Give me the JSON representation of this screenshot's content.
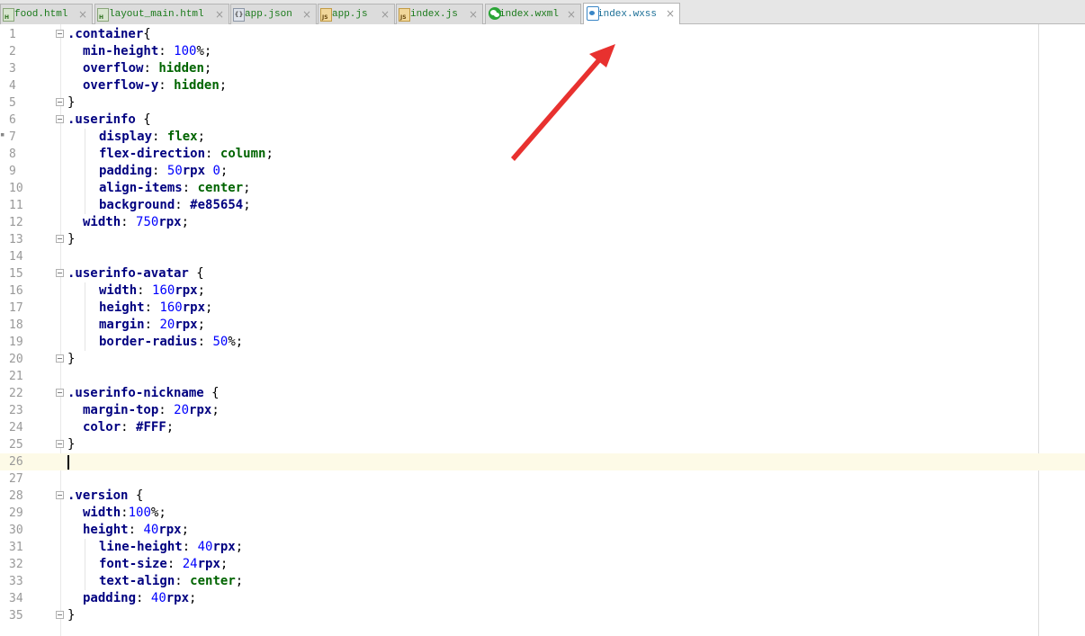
{
  "tabs": [
    {
      "label": "food.html",
      "icon": "html-file-icon",
      "active": false
    },
    {
      "label": "layout_main.html",
      "icon": "html-file-icon",
      "active": false
    },
    {
      "label": "app.json",
      "icon": "json-file-icon",
      "active": false
    },
    {
      "label": "app.js",
      "icon": "js-file-icon",
      "active": false
    },
    {
      "label": "index.js",
      "icon": "js-file-icon",
      "active": false
    },
    {
      "label": "index.wxml",
      "icon": "wechat-file-icon",
      "active": false
    },
    {
      "label": "index.wxss",
      "icon": "wxss-file-icon",
      "active": true
    }
  ],
  "icon_text": {
    "html": "H",
    "js": "JS",
    "json": "{}"
  },
  "close_glyph": "×",
  "editor": {
    "current_line": 26,
    "line_numbers": [
      "1",
      "2",
      "3",
      "4",
      "5",
      "6",
      "7",
      "8",
      "9",
      "10",
      "11",
      "12",
      "13",
      "14",
      "15",
      "16",
      "17",
      "18",
      "19",
      "20",
      "21",
      "22",
      "23",
      "24",
      "25",
      "26",
      "27",
      "28",
      "29",
      "30",
      "31",
      "32",
      "33",
      "34",
      "35"
    ],
    "lines": [
      ".container{",
      "min-height: 100%;",
      "overflow: hidden;",
      "overflow-y: hidden;",
      "}",
      ".userinfo {",
      "display: flex;",
      "flex-direction: column;",
      "padding: 50rpx 0;",
      "align-items: center;",
      "background: #e85654;",
      "width: 750rpx;",
      "}",
      "",
      ".userinfo-avatar {",
      "width: 160rpx;",
      "height: 160rpx;",
      "margin: 20rpx;",
      "border-radius: 50%;",
      "}",
      "",
      ".userinfo-nickname {",
      "margin-top: 20rpx;",
      "color: #FFF;",
      "}",
      "",
      "",
      ".version {",
      "width:100%;",
      "height: 40rpx;",
      "line-height: 40rpx;",
      "font-size: 24rpx;",
      "text-align: center;",
      "padding: 40rpx;",
      "}"
    ]
  },
  "colors": {
    "arrow": "#e8312f",
    "current_line_bg": "#fdfae7",
    "selector": "#000080",
    "keyword": "#006400",
    "number": "#0000ff"
  }
}
